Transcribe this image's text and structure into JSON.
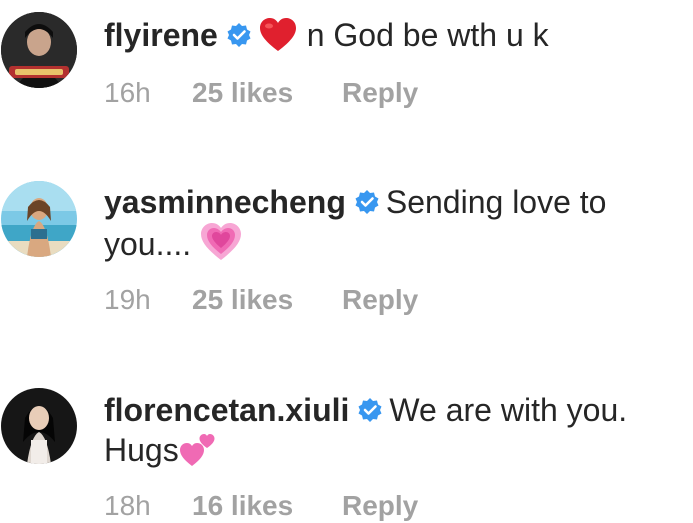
{
  "comments": [
    {
      "username": "flyirene",
      "verified": true,
      "text_before": "",
      "emoji_inline": "red-heart",
      "text": "n God be wth u k",
      "emoji_trailing": "",
      "time": "16h",
      "likes": "25 likes",
      "reply": "Reply"
    },
    {
      "username": "yasminnecheng",
      "verified": true,
      "text": "Sending love to you....",
      "emoji_trailing": "growing-heart",
      "time": "19h",
      "likes": "25 likes",
      "reply": "Reply"
    },
    {
      "username": "florencetan.xiuli",
      "verified": true,
      "text": "We are with you. Hugs",
      "emoji_trailing": "two-hearts",
      "time": "18h",
      "likes": "16 likes",
      "reply": "Reply"
    }
  ],
  "colors": {
    "text": "#262626",
    "meta": "#a2a2a2",
    "verified": "#3897f0",
    "heart": "#e0202e",
    "pink_heart": "#f06ab4"
  }
}
